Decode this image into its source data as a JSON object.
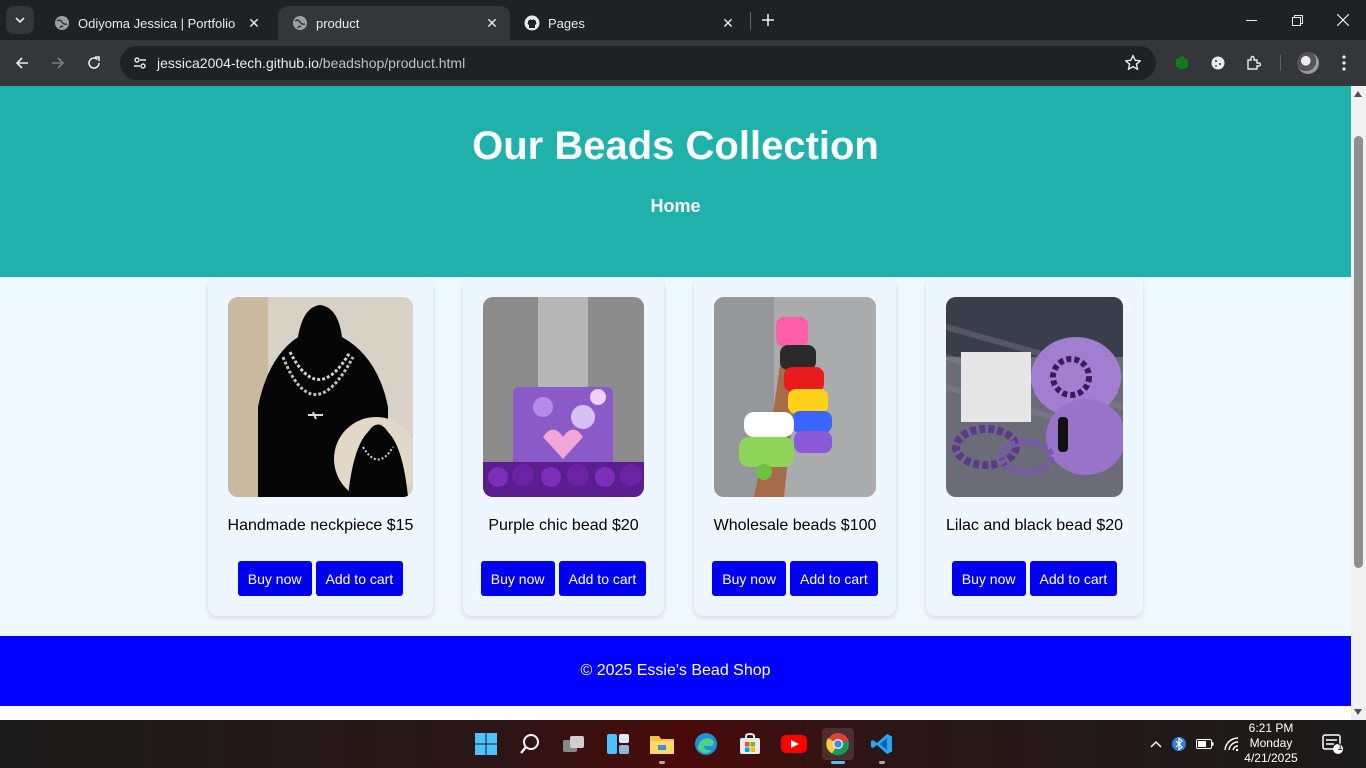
{
  "browser": {
    "tabs": [
      {
        "title": "Odiyoma Jessica | Portfolio",
        "icon": "globe-icon",
        "active": false
      },
      {
        "title": "product",
        "icon": "globe-icon",
        "active": true
      },
      {
        "title": "Pages",
        "icon": "github-icon",
        "active": false
      }
    ],
    "url_host": "jessica2004-tech.github.io",
    "url_path": "/beadshop/product.html"
  },
  "site": {
    "title": "Our Beads Collection",
    "nav_home": "Home",
    "products": [
      {
        "name": "Handmade neckpiece $15",
        "buy": "Buy now",
        "cart": "Add to cart",
        "image": "necklace-photo"
      },
      {
        "name": "Purple chic bead $20",
        "buy": "Buy now",
        "cart": "Add to cart",
        "image": "purple-bead-photo"
      },
      {
        "name": "Wholesale beads $100",
        "buy": "Buy now",
        "cart": "Add to cart",
        "image": "colorful-bracelets-photo"
      },
      {
        "name": "Lilac and black bead $20",
        "buy": "Buy now",
        "cart": "Add to cart",
        "image": "lilac-bracelets-photo"
      }
    ],
    "footer": "© 2025 Essie's Bead Shop"
  },
  "taskbar": {
    "time": "6:21 PM",
    "day": "Monday",
    "date": "4/21/2025",
    "notifications": "1"
  },
  "colors": {
    "header_bg": "#20b2aa",
    "button_bg": "#0000ee",
    "footer_bg": "#0000ff",
    "page_bg": "#f0f8ff"
  }
}
